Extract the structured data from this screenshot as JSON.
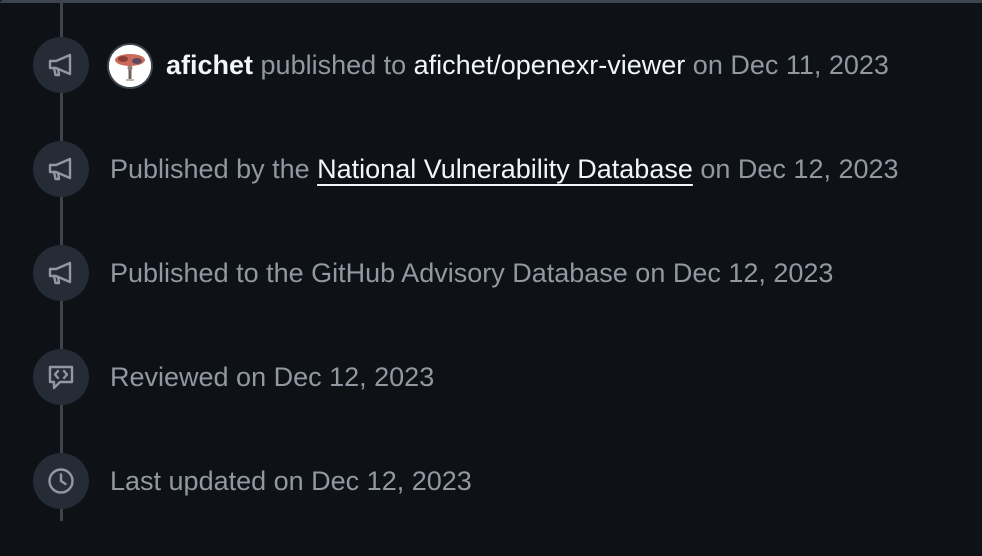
{
  "timeline": {
    "items": [
      {
        "icon": "megaphone-icon",
        "actor": "afichet",
        "action": " published to ",
        "repo": "afichet/openexr-viewer",
        "date_text": " on Dec 11, 2023"
      },
      {
        "icon": "megaphone-icon",
        "prefix": "Published by the ",
        "link": "National Vulnerability Database",
        "date_text": " on Dec 12, 2023"
      },
      {
        "icon": "megaphone-icon",
        "text": "Published to the GitHub Advisory Database on Dec 12, 2023"
      },
      {
        "icon": "code-review-icon",
        "text": "Reviewed on Dec 12, 2023"
      },
      {
        "icon": "clock-icon",
        "text": "Last updated on Dec 12, 2023"
      }
    ]
  },
  "colors": {
    "background": "#0e1116",
    "badge": "#262c36",
    "line": "#3d444d",
    "text_muted": "#9198a1",
    "text_primary": "#f0f6fc"
  }
}
